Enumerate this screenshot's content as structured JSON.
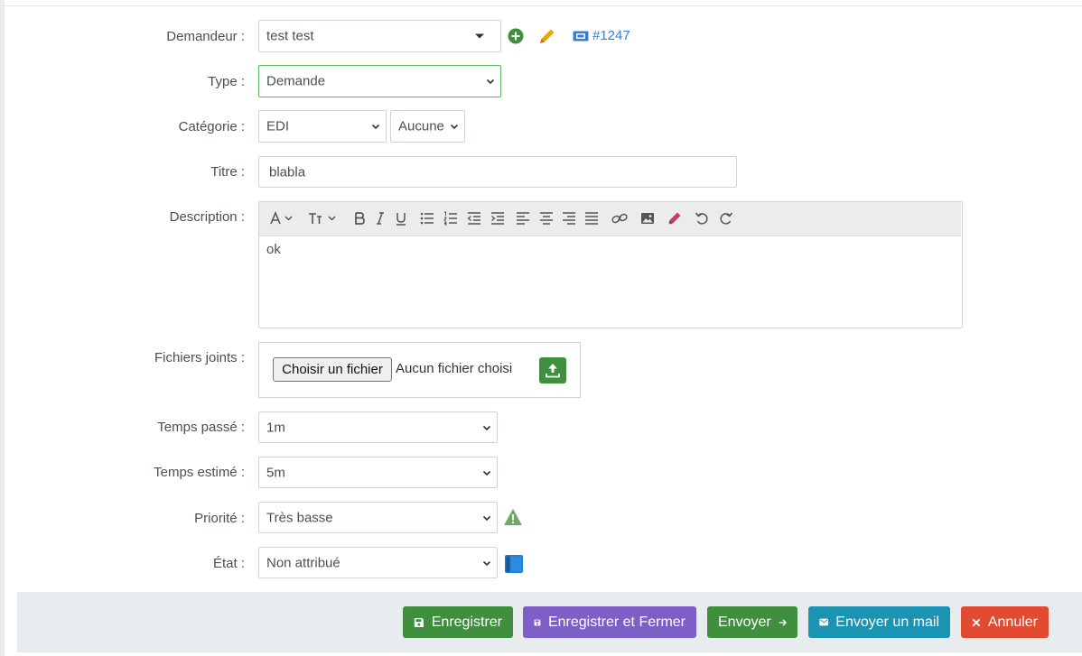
{
  "form": {
    "requester": {
      "label": "Demandeur :",
      "value": "test test",
      "ticket": "#1247"
    },
    "type": {
      "label": "Type :",
      "value": "Demande"
    },
    "category": {
      "label": "Catégorie :",
      "value": "EDI",
      "sub_value": "Aucune"
    },
    "title": {
      "label": "Titre :",
      "value": "blabla"
    },
    "description": {
      "label": "Description :",
      "value": "ok"
    },
    "attachments": {
      "label": "Fichiers joints :",
      "choose_button": "Choisir un fichier",
      "no_file": "Aucun fichier choisi"
    },
    "time_spent": {
      "label": "Temps passé :",
      "value": "1m"
    },
    "time_estimated": {
      "label": "Temps estimé :",
      "value": "5m"
    },
    "priority": {
      "label": "Priorité :",
      "value": "Très basse"
    },
    "state": {
      "label": "État :",
      "value": "Non attribué"
    }
  },
  "footer": {
    "save": "Enregistrer",
    "save_close": "Enregistrer et Fermer",
    "send": "Envoyer",
    "send_mail": "Envoyer un mail",
    "cancel": "Annuler"
  },
  "colors": {
    "green": "#3f8f3f",
    "purple": "#7d5fc6",
    "teal": "#1b93b3",
    "red": "#e24a31",
    "link": "#3a7bd5",
    "pencil": "#e8a317"
  }
}
